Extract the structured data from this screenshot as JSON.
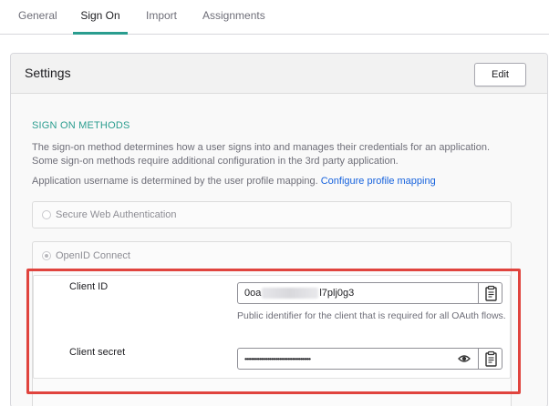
{
  "tabs": [
    {
      "label": "General"
    },
    {
      "label": "Sign On"
    },
    {
      "label": "Import"
    },
    {
      "label": "Assignments"
    }
  ],
  "settings": {
    "title": "Settings",
    "edit_label": "Edit"
  },
  "sign_on": {
    "section_title": "SIGN ON METHODS",
    "description": "The sign-on method determines how a user signs into and manages their credentials for an application. Some sign-on methods require additional configuration in the 3rd party application.",
    "username_note": "Application username is determined by the user profile mapping.",
    "profile_link": "Configure profile mapping",
    "options": [
      {
        "label": "Secure Web Authentication",
        "selected": false
      },
      {
        "label": "OpenID Connect",
        "selected": true
      }
    ]
  },
  "client": {
    "id_label": "Client ID",
    "id_prefix": "0oa",
    "id_suffix": "l7plj0g3",
    "id_helper": "Public identifier for the client that is required for all OAuth flows.",
    "secret_label": "Client secret",
    "secret_value": "••••••••••••••••••••••••••••••••••••••••"
  },
  "colors": {
    "accent": "#2a9d8f",
    "link": "#1662dd",
    "highlight": "#e0443e"
  },
  "icons": {
    "clipboard": "clipboard-icon",
    "eye": "eye-icon",
    "radio": "radio-icon"
  }
}
